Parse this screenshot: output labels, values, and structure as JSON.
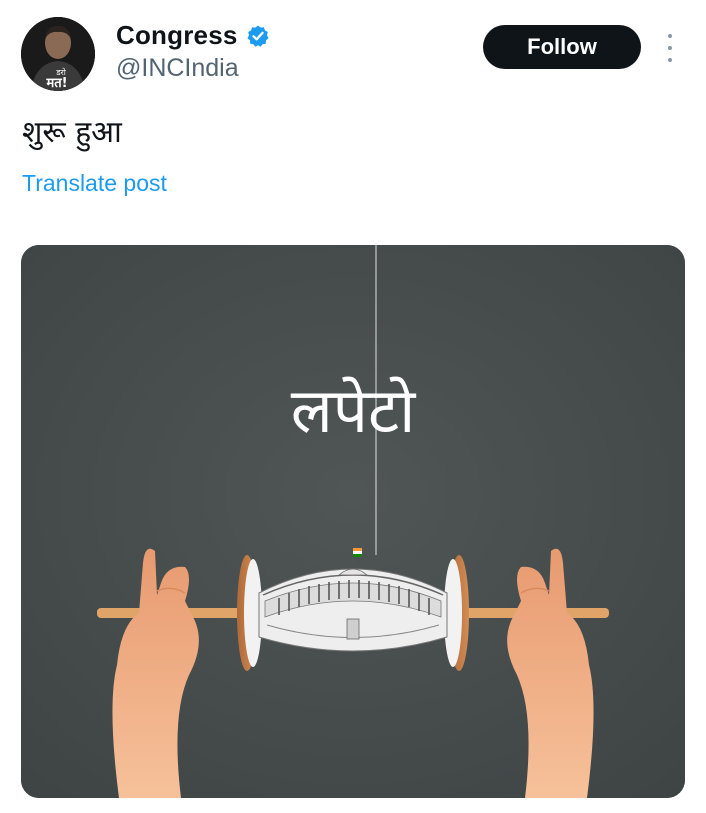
{
  "author": {
    "display_name": "Congress",
    "handle": "@INCIndia",
    "avatar_text": [
      "डरो",
      "मत!"
    ],
    "verified": true,
    "verified_color": "#1d9bf0"
  },
  "actions": {
    "follow_label": "Follow",
    "more_icon": "vertical-ellipsis-icon"
  },
  "post": {
    "text": "शुरू हुआ",
    "translate_label": "Translate post"
  },
  "media": {
    "caption": "लपेटो",
    "background_color": "#464c4c"
  }
}
